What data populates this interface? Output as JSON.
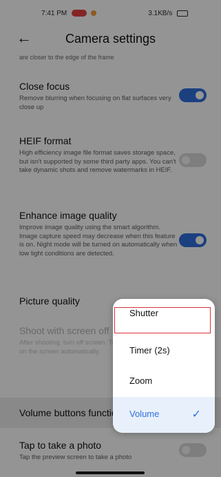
{
  "status_bar": {
    "time": "7:41 PM",
    "right": "3.1KB/s"
  },
  "header": {
    "back_icon": "arrow-left-icon",
    "title": "Camera settings"
  },
  "clipped_text": "are closer to the edge of the frame",
  "settings": {
    "close_focus": {
      "title": "Close focus",
      "desc": "Remove blurring when focusing on flat surfaces very close up",
      "on": true
    },
    "heif": {
      "title": "HEIF format",
      "desc": "High efficiency image file format saves storage space, but isn't supported by some third party apps. You can't take dynamic shots and remove watermarks in HEIF.",
      "on": false
    },
    "enhance": {
      "title": "Enhance image quality",
      "desc": "Improve image quality using the smart algorithm. Image capture speed may decrease when this feature is on. Night mode will be turned on automatically when low light conditions are detected.",
      "on": true
    },
    "picture_quality": {
      "title": "Picture quality"
    },
    "shoot_screen_off": {
      "title": "Shoot with screen off",
      "desc": "After shooting, turn off screen. Tap to turn on the screen automatically."
    },
    "volume_buttons": {
      "title": "Volume buttons function"
    },
    "tap_photo": {
      "title": "Tap to take a photo",
      "desc": "Tap the preview screen to take a photo",
      "on": false
    }
  },
  "menu": {
    "items": [
      {
        "label": "Shutter"
      },
      {
        "label": "Timer (2s)"
      },
      {
        "label": "Zoom"
      },
      {
        "label": "Volume",
        "check_icon": "check-icon"
      }
    ]
  },
  "colors": {
    "accent": "#2f6fdc",
    "highlight": "#d8323a"
  }
}
